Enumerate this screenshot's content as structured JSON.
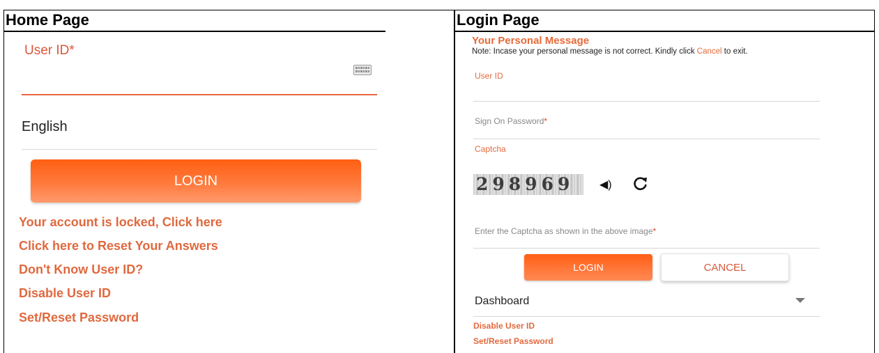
{
  "headers": {
    "left": "Home Page",
    "right": "Login Page"
  },
  "home": {
    "userid_label": "User ID*",
    "keyboard_icon": "keyboard-icon",
    "language_value": "English",
    "login_label": "LOGIN",
    "links": [
      "Your account is locked, Click here",
      "Click here to Reset Your Answers",
      "Don't Know User ID?",
      "Disable User ID",
      "Set/Reset Password"
    ]
  },
  "login": {
    "title": "Your Personal Message",
    "note_prefix": "Note: Incase your personal message is not correct. Kindly click ",
    "note_link": "Cancel",
    "note_suffix": " to exit.",
    "userid_label": "User ID",
    "password_label": "Sign On Password",
    "required_mark": "*",
    "captcha_label": "Captcha",
    "captcha_value": "298969",
    "audio_icon": "speaker-icon",
    "refresh_icon": "refresh-icon",
    "captcha_input_label": "Enter the Captcha as shown in the above image",
    "login_label": "LOGIN",
    "cancel_label": "CANCEL",
    "dashboard_value": "Dashboard",
    "links": [
      "Disable User ID",
      "Set/Reset Password"
    ]
  },
  "colors": {
    "accent": "#ff5f12",
    "link": "#e0693f"
  }
}
